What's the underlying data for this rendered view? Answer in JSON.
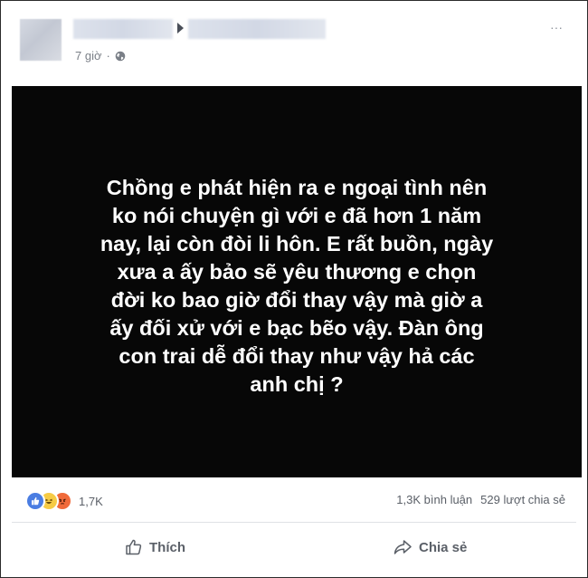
{
  "post": {
    "time": "7 giờ",
    "time_separator": "·",
    "privacy_icon": "globe-icon",
    "options_label": "···",
    "arrow_icon": "caret-right-icon",
    "body_text": "Chồng e phát hiện ra e ngoại tình nên ko nói chuyện gì với e đã hơn 1 năm nay, lại còn đòi li hôn. E rất buồn, ngày xưa a ấy bảo sẽ yêu thương e chọn đời ko bao giờ đổi thay vậy mà giờ a ấy đối xử với e bạc bẽo vậy. Đàn ông con trai dễ đổi thay như vậy hả các anh chị ?",
    "background_color": "#070707"
  },
  "reactions": {
    "icons": [
      "like-icon",
      "haha-icon",
      "angry-icon"
    ],
    "count": "1,7K"
  },
  "stats": {
    "comments": "1,3K bình luận",
    "shares": "529 lượt chia sẻ"
  },
  "actions": {
    "like_label": "Thích",
    "share_label": "Chia sẻ"
  },
  "colors": {
    "like_blue": "#4a7de2",
    "haha_yellow": "#f6cb45",
    "angry_orange": "#f06a3a",
    "muted_text": "#5b6068"
  }
}
